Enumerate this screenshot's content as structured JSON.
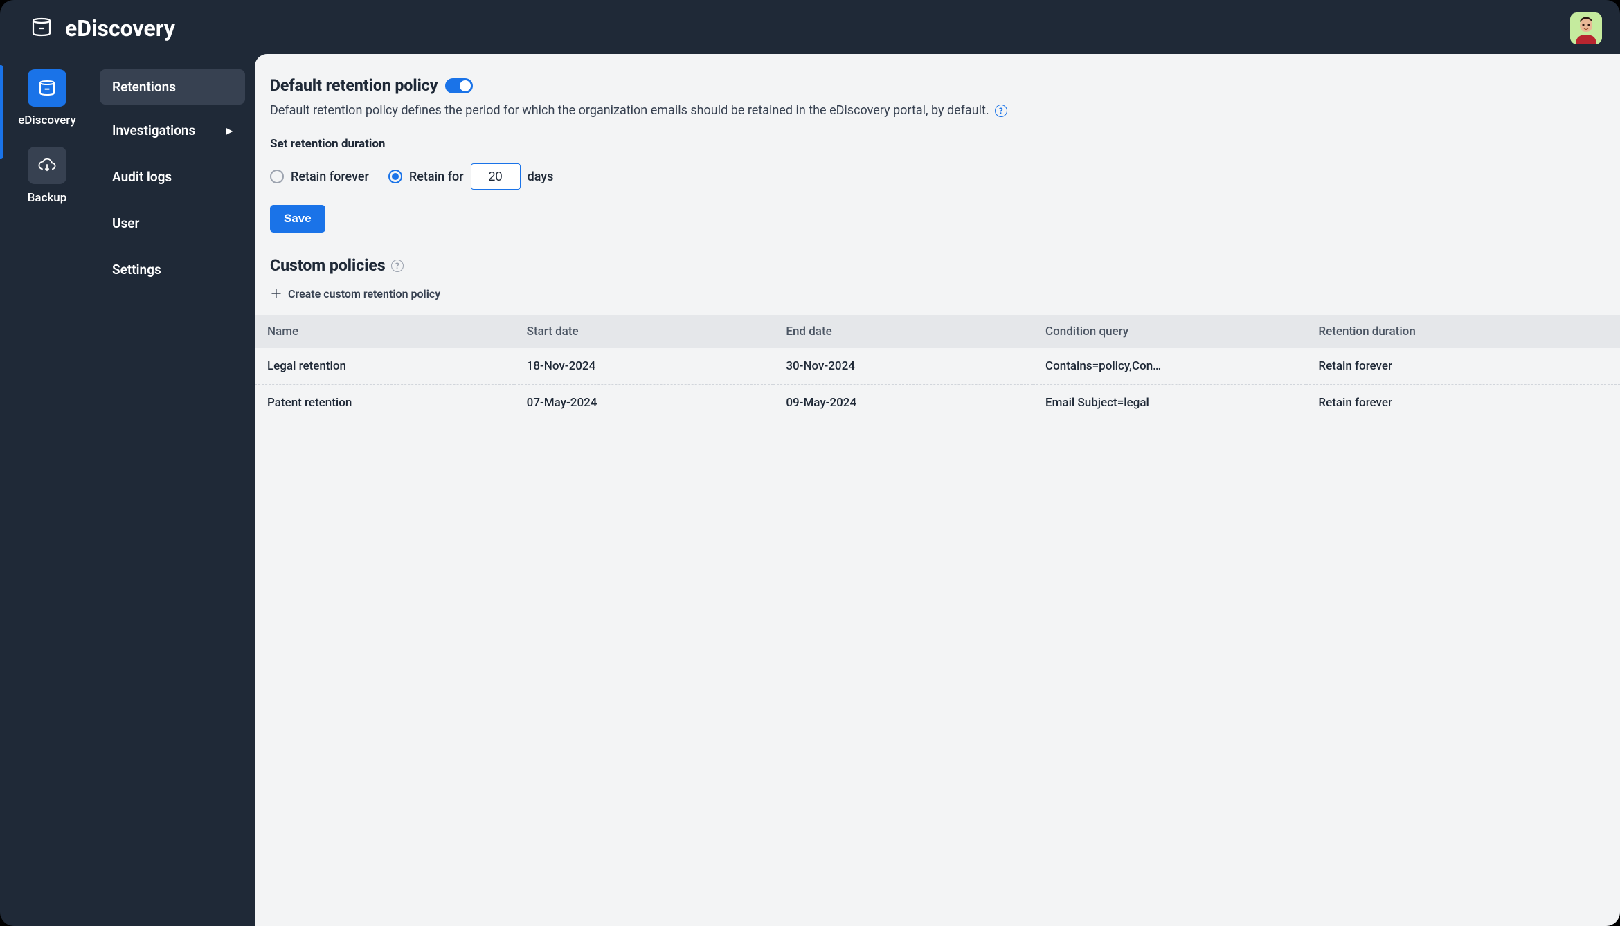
{
  "header": {
    "app_title": "eDiscovery"
  },
  "rail": {
    "items": [
      {
        "label": "eDiscovery",
        "active": true,
        "icon": "archive"
      },
      {
        "label": "Backup",
        "active": false,
        "icon": "cloud-backup"
      }
    ]
  },
  "sidenav": {
    "items": [
      {
        "label": "Retentions",
        "active": true,
        "has_submenu": false
      },
      {
        "label": "Investigations",
        "active": false,
        "has_submenu": true
      },
      {
        "label": "Audit logs",
        "active": false,
        "has_submenu": false
      },
      {
        "label": "User",
        "active": false,
        "has_submenu": false
      },
      {
        "label": "Settings",
        "active": false,
        "has_submenu": false
      }
    ]
  },
  "main": {
    "title": "Default retention policy",
    "toggle_on": true,
    "description": "Default retention policy defines the period for which the organization emails should be retained in the eDiscovery portal, by default.",
    "set_duration_heading": "Set retention duration",
    "radios": {
      "retain_forever_label": "Retain forever",
      "retain_forever_checked": false,
      "retain_for_label": "Retain for",
      "retain_for_checked": true,
      "retain_for_value": "20",
      "retain_for_unit": "days"
    },
    "save_label": "Save",
    "custom_policies_heading": "Custom policies",
    "create_link_label": "Create custom retention policy",
    "table": {
      "columns": [
        "Name",
        "Start date",
        "End date",
        "Condition query",
        "Retention duration"
      ],
      "rows": [
        {
          "name": "Legal retention",
          "start_date": "18-Nov-2024",
          "end_date": "30-Nov-2024",
          "condition": "Contains=policy,Conte…",
          "retention": "Retain forever"
        },
        {
          "name": "Patent retention",
          "start_date": "07-May-2024",
          "end_date": "09-May-2024",
          "condition": "Email Subject=legal",
          "retention": "Retain forever"
        }
      ]
    }
  }
}
